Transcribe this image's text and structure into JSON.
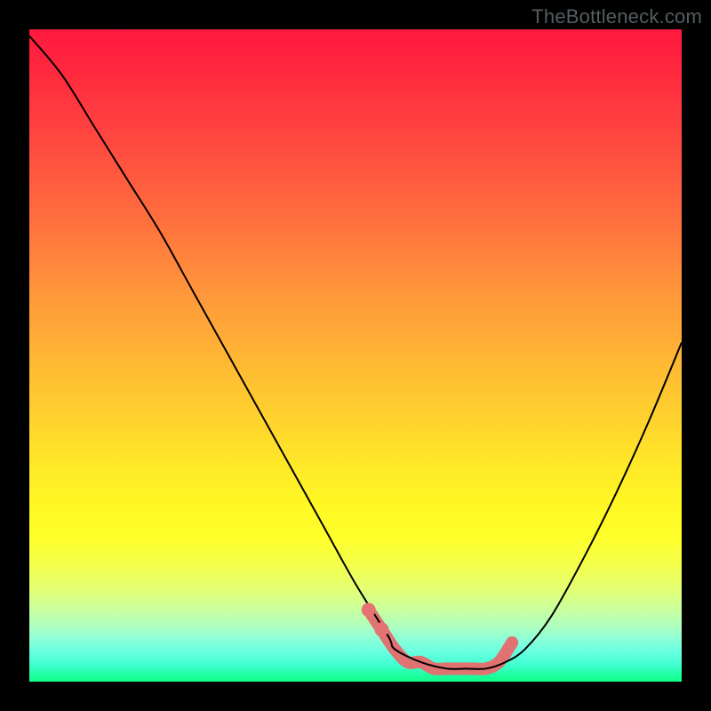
{
  "watermark": "TheBottleneck.com",
  "colors": {
    "curve_black": "#000000",
    "highlight_pink": "#e07272",
    "highlight_dot": "#e57373"
  },
  "chart_data": {
    "type": "line",
    "title": "",
    "xlabel": "",
    "ylabel": "",
    "xlim": [
      0,
      100
    ],
    "ylim": [
      0,
      100
    ],
    "series": [
      {
        "name": "bottleneck-curve",
        "x": [
          0,
          5,
          10,
          15,
          20,
          25,
          30,
          35,
          40,
          45,
          50,
          55,
          56,
          60,
          64,
          67,
          70,
          73,
          76,
          80,
          85,
          90,
          95,
          100
        ],
        "y": [
          99,
          93,
          85,
          77,
          69,
          60,
          51,
          42,
          33,
          24,
          15,
          7,
          5,
          3,
          2,
          2,
          2,
          3,
          5,
          10,
          19,
          29,
          40,
          52
        ]
      }
    ],
    "highlight_region": {
      "name": "optimal-range-marker",
      "x": [
        52,
        54,
        56,
        58,
        60,
        62,
        64,
        66,
        68,
        70,
        72,
        74
      ],
      "y": [
        11,
        8,
        5,
        3,
        3,
        2,
        2,
        2,
        2,
        2,
        3,
        6
      ]
    },
    "highlight_dots": [
      {
        "x": 52,
        "y": 11
      },
      {
        "x": 54,
        "y": 8
      }
    ]
  }
}
